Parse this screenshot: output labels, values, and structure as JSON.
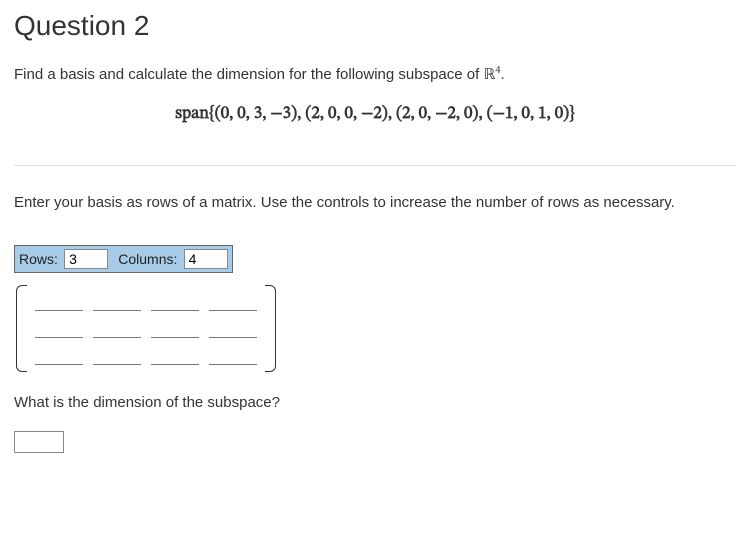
{
  "title": "Question 2",
  "prompt_prefix": "Find a basis and calculate the dimension for the following subspace of ",
  "space_symbol": "ℝ",
  "space_power": "4",
  "span_label": "span",
  "span_set": "{(0, 0, 3, −3), (2, 0, 0, −2), (2, 0, −2, 0), (−1, 0, 1, 0)}",
  "instruction": "Enter your basis as rows of a matrix.  Use the controls to increase the number of rows as necessary.",
  "controls": {
    "rows_label": "Rows:",
    "rows_value": "3",
    "cols_label": "Columns:",
    "cols_value": "4"
  },
  "matrix": {
    "rows": 3,
    "cols": 4,
    "cells": [
      [
        "",
        "",
        "",
        ""
      ],
      [
        "",
        "",
        "",
        ""
      ],
      [
        "",
        "",
        "",
        ""
      ]
    ]
  },
  "dimension_question": "What is the dimension of the subspace?",
  "dimension_value": ""
}
